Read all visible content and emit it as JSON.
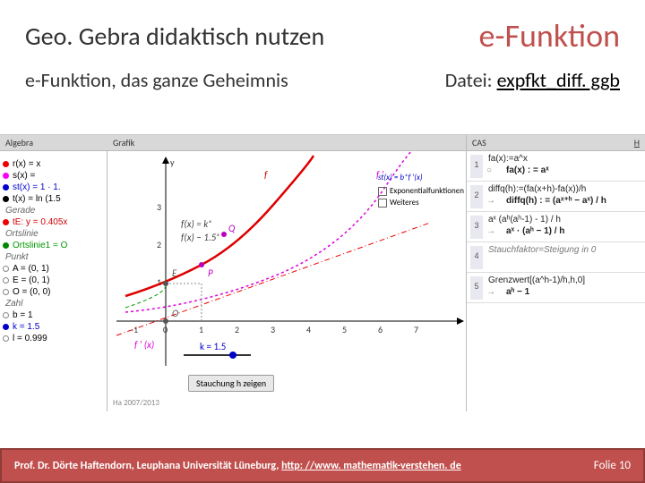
{
  "header": {
    "title_left": "Geo. Gebra didaktisch nutzen",
    "title_right": "e-Funktion"
  },
  "subheader": {
    "left": "e-Funktion, das ganze Geheimnis",
    "right_prefix": "Datei:",
    "right_link": "expfkt_diff. ggb"
  },
  "panels": {
    "algebra_title": "Algebra",
    "grafik_title": "Grafik",
    "cas_title": "CAS"
  },
  "algebra": {
    "rows": [
      {
        "bullet": "b-red",
        "txt": "r(x) = x",
        "cls": ""
      },
      {
        "bullet": "b-magenta",
        "txt": "s(x) =",
        "cls": ""
      },
      {
        "bullet": "b-blue",
        "txt": "st(x) = 1 · 1.",
        "cls": "blue-txt"
      },
      {
        "bullet": "b-black",
        "txt": "t(x) = ln (1.5",
        "cls": ""
      }
    ],
    "groups": [
      {
        "label": "Gerade",
        "rows": [
          {
            "bullet": "b-red",
            "txt": "tE: y = 0.405x",
            "cls": "red-txt"
          }
        ]
      },
      {
        "label": "Ortslinie",
        "rows": [
          {
            "bullet": "b-green",
            "txt": "Ortslinie1 = O",
            "cls": "green-txt"
          }
        ]
      },
      {
        "label": "Punkt",
        "rows": [
          {
            "bullet": "b-none",
            "txt": "A = (0, 1)",
            "cls": ""
          },
          {
            "bullet": "b-none",
            "txt": "E = (0, 1)",
            "cls": ""
          },
          {
            "bullet": "b-none",
            "txt": "O = (0, 0)",
            "cls": ""
          }
        ]
      },
      {
        "label": "Zahl",
        "rows": [
          {
            "bullet": "b-none",
            "txt": "b = 1",
            "cls": ""
          },
          {
            "bullet": "b-blue",
            "txt": "k = 1.5",
            "cls": "blue-txt"
          },
          {
            "bullet": "b-none",
            "txt": "l = 0.999",
            "cls": ""
          }
        ]
      }
    ]
  },
  "graph": {
    "labels": {
      "f": "f",
      "fprime": "f '",
      "fq": "f(x) = kˣ",
      "fp": "f(x) − 1.5ˣ",
      "Q": "Q",
      "P": "P",
      "E": "E",
      "O": "O",
      "y": "y",
      "stx": "st(x) = b*f '(x)",
      "fprime_x": "f ' (x)",
      "ticks": [
        "-1",
        "0",
        "1",
        "2",
        "3",
        "4",
        "5",
        "6",
        "7"
      ],
      "yticks": [
        "1",
        "2",
        "3"
      ]
    },
    "slider_label": "k = 1.5",
    "buttons": {
      "chk1": "Exponentialfunktionen",
      "chk2": "Weiteres",
      "btn": "Stauchung h zeigen"
    },
    "credit": "Ha 2007/2013"
  },
  "cas": {
    "rows": [
      {
        "n": "1",
        "in": "fa(x):=a^x",
        "out": "fa(x) : = aˣ"
      },
      {
        "n": "2",
        "in": "diffq(h):=(fa(x+h)-fa(x))/h",
        "out": "diffq(h) : = (aˣ⁺ʰ − aˣ) / h"
      },
      {
        "n": "3",
        "in": "aˣ (aʰ(aʰ-1) - 1) / h",
        "out": "aˣ · (aʰ − 1) / h"
      },
      {
        "n": "4",
        "in_note": "Stauchfaktor=Steigung in 0",
        "out": ""
      },
      {
        "n": "5",
        "in": "Grenzwert[(a^h-1)/h,h,0]",
        "out": "aʰ − 1"
      }
    ]
  },
  "chart_data": {
    "type": "line",
    "title": "",
    "xlabel": "",
    "ylabel": "y",
    "xlim": [
      -1.2,
      7.5
    ],
    "ylim": [
      -0.8,
      3.5
    ],
    "series": [
      {
        "name": "f (k^x, k=1.5)",
        "color": "#d00",
        "points": [
          [
            -1,
            0.667
          ],
          [
            0,
            1
          ],
          [
            1,
            1.5
          ],
          [
            2,
            2.25
          ],
          [
            3,
            3.375
          ]
        ]
      },
      {
        "name": "f ' (dashed)",
        "color": "#d0d",
        "points": [
          [
            -1,
            0.27
          ],
          [
            0,
            0.405
          ],
          [
            1,
            0.608
          ],
          [
            2,
            0.912
          ],
          [
            3,
            1.368
          ],
          [
            4,
            2.05
          ],
          [
            5,
            3.08
          ]
        ]
      },
      {
        "name": "tE tangent y=0.405x",
        "color": "#e00",
        "points": [
          [
            -1,
            -0.405
          ],
          [
            5,
            2.03
          ]
        ]
      }
    ],
    "points": [
      {
        "name": "O",
        "xy": [
          0,
          0
        ]
      },
      {
        "name": "E",
        "xy": [
          0,
          1
        ]
      },
      {
        "name": "P",
        "xy": [
          1,
          1.5
        ]
      },
      {
        "name": "Q",
        "xy": [
          1,
          2.0
        ]
      }
    ],
    "slider": {
      "name": "k",
      "value": 1.5,
      "min": 0,
      "max": 2
    }
  },
  "footer": {
    "author": "Prof. Dr. Dörte Haftendorn, Leuphana Universität Lüneburg,",
    "url": "http: //www. mathematik-verstehen. de",
    "folie": "Folie 10"
  }
}
